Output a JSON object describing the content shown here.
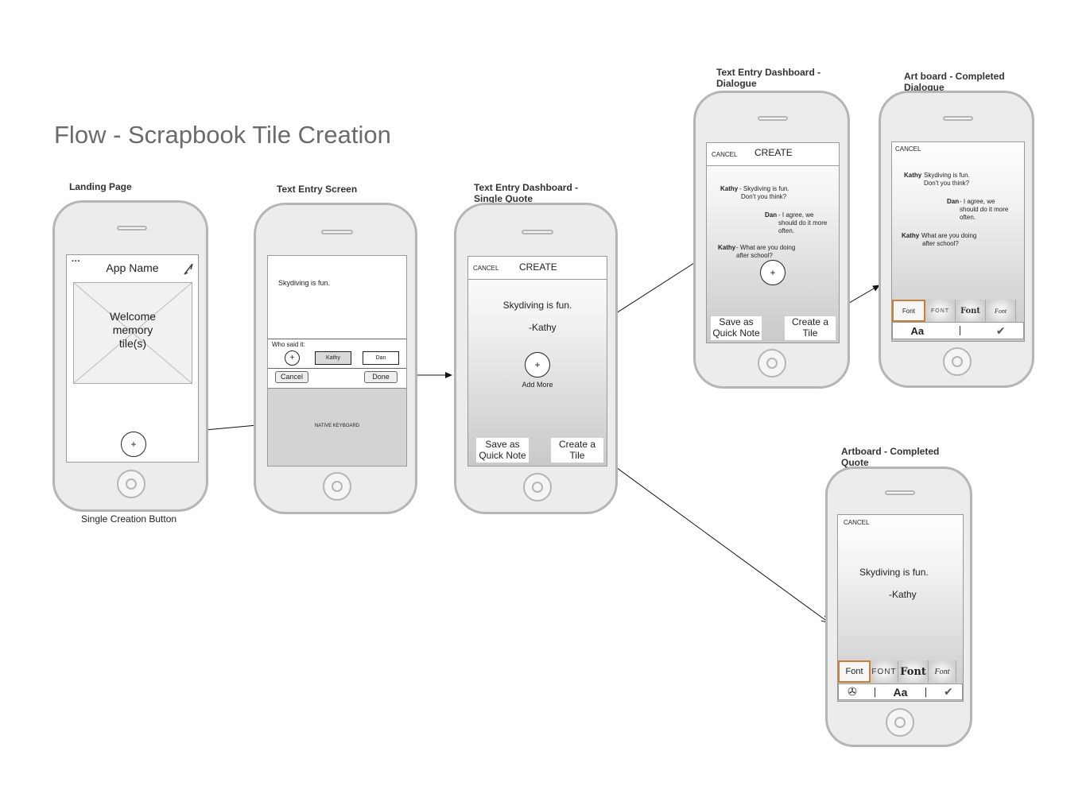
{
  "title": "Flow - Scrapbook Tile Creation",
  "screens": {
    "landing": {
      "caption": "Landing Page",
      "menu": "···",
      "app_name": "App Name",
      "placeholder_lines": [
        "Welcome",
        "memory",
        "tile(s)"
      ],
      "plus": "+",
      "footnote": "Single Creation Button"
    },
    "text_entry": {
      "caption": "Text Entry Screen",
      "text": "Skydiving is fun.",
      "who_said": "Who said it:",
      "plus": "+",
      "speakers": [
        "Kathy",
        "Dan"
      ],
      "cancel": "Cancel",
      "done": "Done",
      "keyboard": "NATIVE KEYBOARD"
    },
    "dash_single": {
      "caption_lines": [
        "Text Entry Dashboard -",
        "Single Quote"
      ],
      "cancel": "CANCEL",
      "create": "CREATE",
      "quote": "Skydiving is fun.",
      "author": "-Kathy",
      "plus": "+",
      "add_more": "Add More",
      "save_lines": [
        "Save as",
        "Quick Note"
      ],
      "tile_lines": [
        "Create a",
        "Tile"
      ]
    },
    "dash_dialogue": {
      "caption_lines": [
        "Text Entry Dashboard -",
        "Dialogue"
      ],
      "cancel": "CANCEL",
      "create": "CREATE",
      "line1_speaker": "Kathy",
      "line1_text": [
        "- Skydiving is fun.",
        "Don't you think?"
      ],
      "line2_speaker": "Dan",
      "line2_text": [
        "- I agree, we",
        "should do it more",
        "often."
      ],
      "line3_speaker": "Kathy",
      "line3_text": [
        "- What are you doing",
        "after school?"
      ],
      "plus": "+",
      "save_lines": [
        "Save as",
        "Quick Note"
      ],
      "tile_lines": [
        "Create a",
        "Tile"
      ]
    },
    "art_dialogue": {
      "caption_lines": [
        "Art board - Completed",
        "Dialogue"
      ],
      "cancel": "CANCEL",
      "line1_speaker": "Kathy",
      "line1_text": [
        "Skydiving is fun.",
        "Don't you think?"
      ],
      "line2_speaker": "Dan",
      "line2_text": [
        "- I agree, we",
        "should do it more",
        "often."
      ],
      "line3_speaker": "Kathy",
      "line3_text": [
        "What are you doing",
        "after school?"
      ],
      "fonts": [
        "Font",
        "FONT",
        "Font",
        "Font"
      ],
      "aa": "Aa",
      "check": "✔"
    },
    "art_quote": {
      "caption_lines": [
        "Artboard - Completed",
        "Quote"
      ],
      "cancel": "CANCEL",
      "quote": "Skydiving is fun.",
      "author": "-Kathy",
      "fonts": [
        "Font",
        "FONT",
        "Font",
        "Font"
      ],
      "camera_icon": "✇",
      "aa": "Aa",
      "check": "✔"
    }
  },
  "colors": {
    "phone_border": "#b5b5b5",
    "phone_fill": "#ececec",
    "selected_font_border": "#c87f3a",
    "title_gray": "#6b6b6b"
  }
}
